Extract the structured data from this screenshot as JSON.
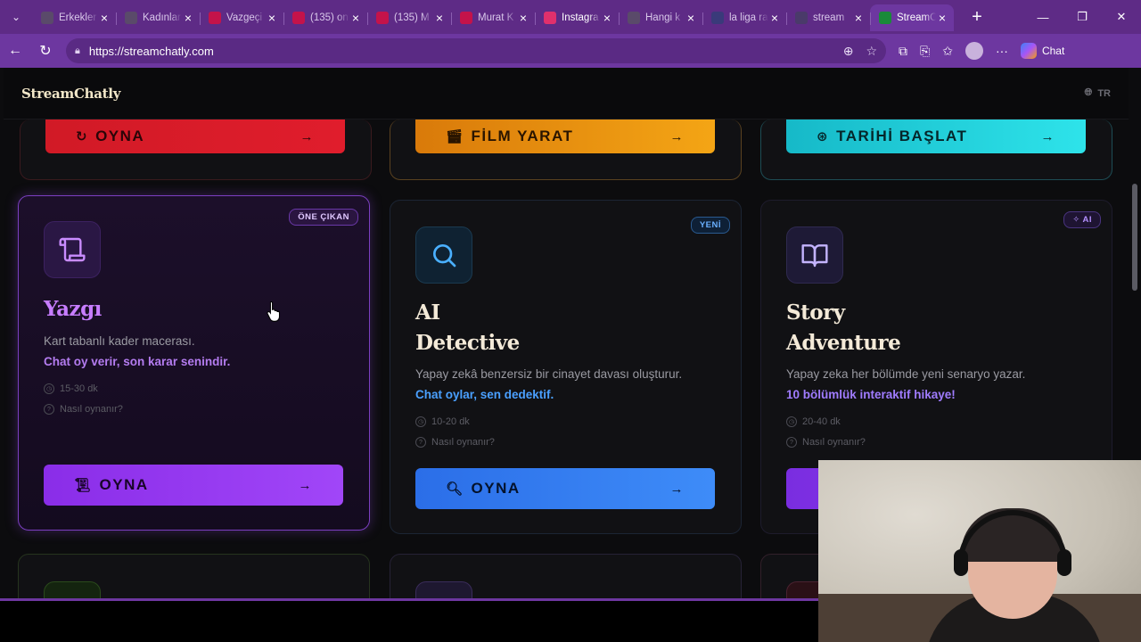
{
  "browser": {
    "tabs": [
      {
        "label": "Erkekler",
        "fav_color": "#5a4a6a"
      },
      {
        "label": "Kadınlar",
        "fav_color": "#5a4a6a"
      },
      {
        "label": "Vazgeçi",
        "fav_color": "#c4134a"
      },
      {
        "label": "(135) on",
        "fav_color": "#c4134a"
      },
      {
        "label": "(135) M",
        "fav_color": "#c4134a"
      },
      {
        "label": "Murat K",
        "fav_color": "#c4134a"
      },
      {
        "label": "Instagra",
        "fav_color": "#e1306c"
      },
      {
        "label": "Hangi k",
        "fav_color": "#5a4a6a"
      },
      {
        "label": "la liga ra",
        "fav_color": "#3a3a7a"
      },
      {
        "label": "stream",
        "fav_color": "#4a3a6a"
      },
      {
        "label": "StreamC",
        "fav_color": "#1a8a3a",
        "active": true
      }
    ],
    "url": "https://streamchatly.com",
    "chat_label": "Chat"
  },
  "site": {
    "logo": "StreamChatly",
    "lang": "TR"
  },
  "top_cards": [
    {
      "button_label": "OYNA",
      "icon": "circle-arrow-icon"
    },
    {
      "button_label": "FİLM YARAT",
      "icon": "clapperboard-icon"
    },
    {
      "button_label": "TARİHİ BAŞLAT",
      "icon": "globe-icon"
    }
  ],
  "games": [
    {
      "badge": "ÖNE ÇIKAN",
      "title": "Yazgı",
      "description": "Kart tabanlı kader macerası.",
      "highlight": "Chat oy verir, son karar senindir.",
      "duration": "15-30 dk",
      "how_to": "Nasıl oynanır?",
      "button_label": "OYNA",
      "icon": "scroll-icon"
    },
    {
      "badge": "YENİ",
      "title_line1": "AI",
      "title_line2": "Detective",
      "description": "Yapay zekâ benzersiz bir cinayet davası oluşturur.",
      "highlight": "Chat oylar, sen dedektif.",
      "duration": "10-20 dk",
      "how_to": "Nasıl oynanır?",
      "button_label": "OYNA",
      "icon": "magnifier-icon"
    },
    {
      "badge": "AI",
      "title_line1": "Story",
      "title_line2": "Adventure",
      "description": "Yapay zeka her bölümde yeni senaryo yazar.",
      "highlight": "10 bölümlük interaktif hikaye!",
      "duration": "20-40 dk",
      "how_to": "Nasıl oynanır?",
      "icon": "book-icon"
    }
  ]
}
